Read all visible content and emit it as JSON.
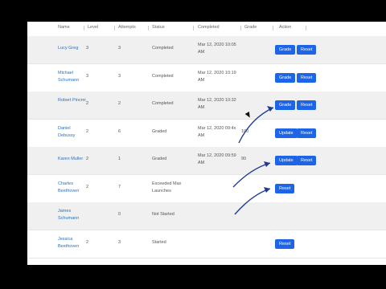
{
  "headers": [
    "Name",
    "Level",
    "Attempts",
    "Status",
    "Completed",
    "Grade",
    "Action"
  ],
  "rows": [
    {
      "name": "Lucy Greg",
      "level": "3",
      "attempts": "3",
      "status": "Completed",
      "completed": "Mar 12, 2020 10:05 AM",
      "grade": "",
      "actions": [
        "Grade",
        "Reset"
      ]
    },
    {
      "name": "Michael Schumann",
      "level": "3",
      "attempts": "3",
      "status": "Completed",
      "completed": "Mar 12, 2020 10:19 AM",
      "grade": "",
      "actions": [
        "Grade",
        "Reset"
      ]
    },
    {
      "name": "Robert Pincmi",
      "level": "2",
      "attempts": "2",
      "status": "Completed",
      "completed": "Mar 12, 2020 10:32 AM",
      "grade": "",
      "actions": [
        "Grade",
        "Reset"
      ]
    },
    {
      "name": "Daniel Debussy",
      "level": "2",
      "attempts": "6",
      "status": "Graded",
      "completed": "Mar 12, 2020 09:4x AM",
      "grade": "100",
      "actions": [
        "Update",
        "Reset"
      ]
    },
    {
      "name": "Karen Muller",
      "level": "2",
      "attempts": "1",
      "status": "Graded",
      "completed": "Mar 12, 2020 09:59 AM",
      "grade": "90",
      "actions": [
        "Update",
        "Reset"
      ]
    },
    {
      "name": "Charles Beethoven",
      "level": "2",
      "attempts": "7",
      "status": "Exceeded Max Launches",
      "completed": "",
      "grade": "",
      "actions": [
        "Reset"
      ]
    },
    {
      "name": "James Schumann",
      "level": "",
      "attempts": "0",
      "status": "Not Started",
      "completed": "",
      "grade": "",
      "actions": []
    },
    {
      "name": "Jessica Beethoven",
      "level": "2",
      "attempts": "3",
      "status": "Started",
      "completed": "",
      "grade": "",
      "actions": [
        "Reset"
      ]
    }
  ],
  "colors": {
    "accent": "#1d64e6",
    "link": "#2d6fb8",
    "annotation": "#1f3a93"
  }
}
